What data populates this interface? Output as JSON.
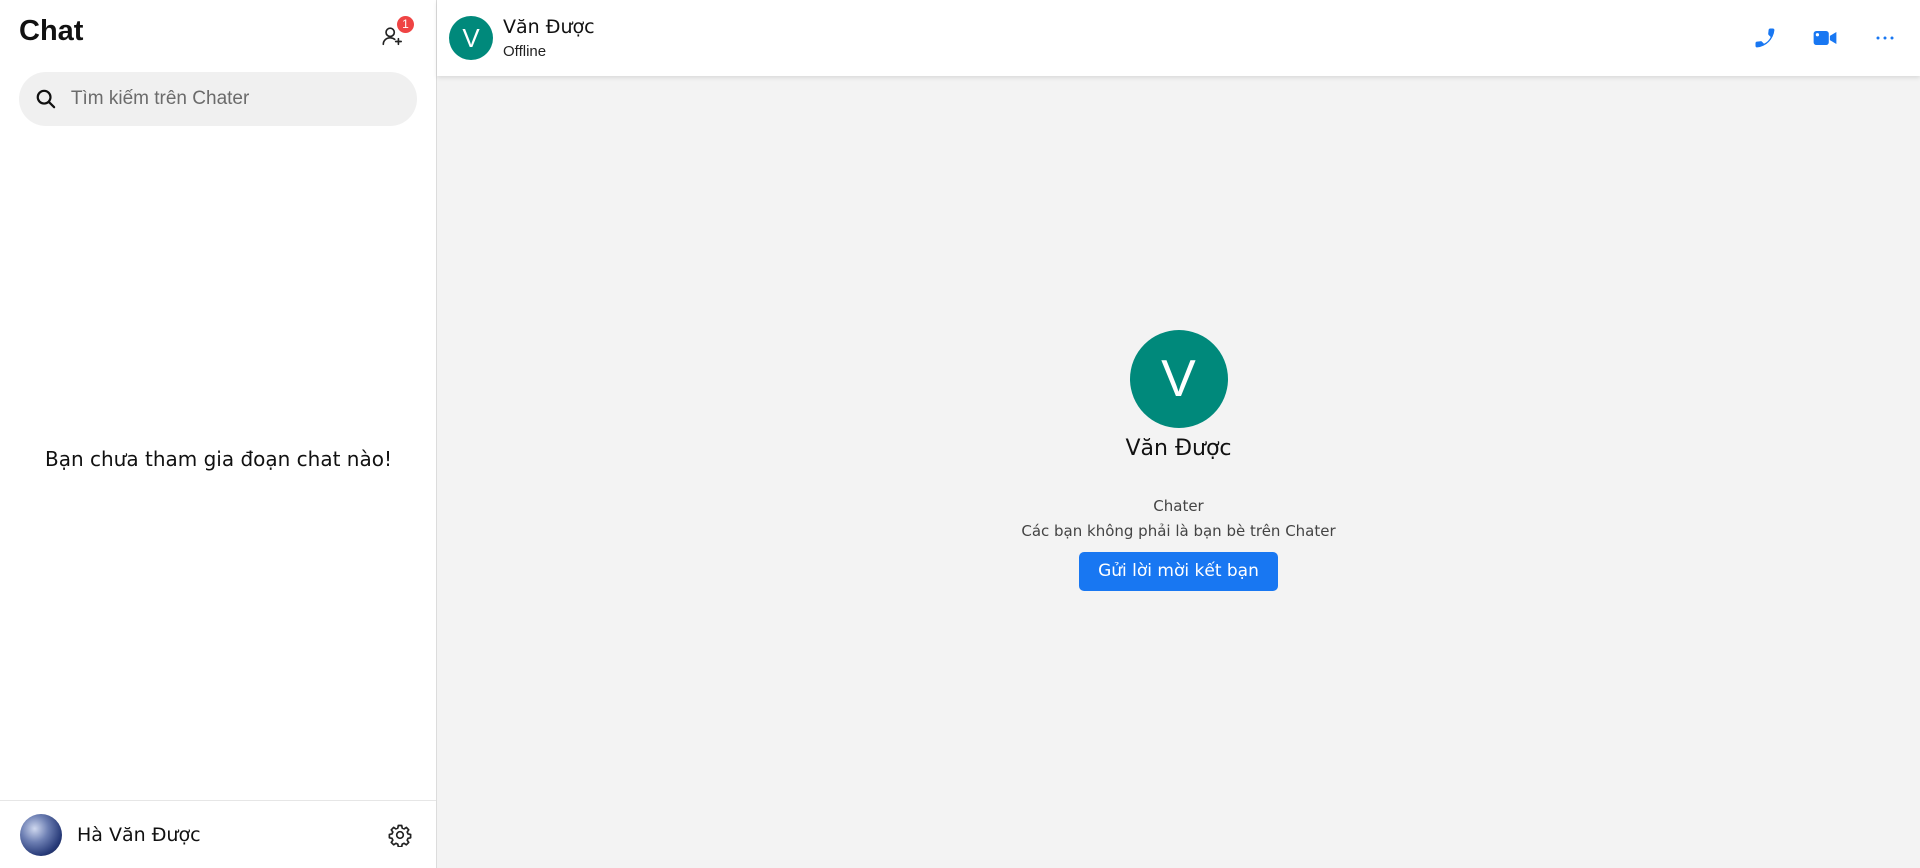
{
  "sidebar": {
    "title": "Chat",
    "friend_requests_badge": "1",
    "search": {
      "placeholder": "Tìm kiếm trên Chater",
      "value": ""
    },
    "empty_message": "Bạn chưa tham gia đoạn chat nào!",
    "current_user": {
      "name": "Hà Văn Được"
    }
  },
  "conversation": {
    "contact_initial": "V",
    "contact_name": "Văn Được",
    "contact_status": "Offline",
    "profile": {
      "initial": "V",
      "name": "Văn Được",
      "app_name": "Chater",
      "relationship_note": "Các bạn không phải là bạn bè trên Chater",
      "add_friend_label": "Gửi lời mời kết bạn"
    }
  },
  "colors": {
    "accent": "#1877f2",
    "avatar_bg": "#00897b",
    "badge": "#ef4444"
  },
  "icons": [
    "user-plus-icon",
    "search-icon",
    "gear-icon",
    "phone-icon",
    "video-icon",
    "more-icon"
  ]
}
